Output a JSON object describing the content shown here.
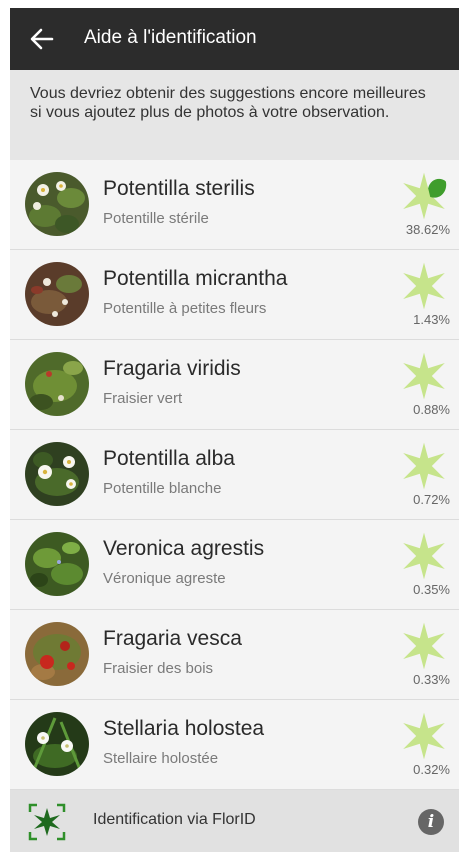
{
  "header": {
    "title": "Aide à l'identification",
    "back_icon": "arrow-left-icon"
  },
  "notice": {
    "text": "Vous devriez obtenir des suggestions encore meilleures si vous ajoutez plus de photos à votre observation."
  },
  "results": [
    {
      "scientific": "Potentilla sterilis",
      "common": "Potentille stérile",
      "percent": "38.62%",
      "score": 0.3862
    },
    {
      "scientific": "Potentilla micrantha",
      "common": "Potentille à petites fleurs",
      "percent": "1.43%",
      "score": 0.0143
    },
    {
      "scientific": "Fragaria viridis",
      "common": "Fraisier vert",
      "percent": "0.88%",
      "score": 0.0088
    },
    {
      "scientific": "Potentilla alba",
      "common": "Potentille blanche",
      "percent": "0.72%",
      "score": 0.0072
    },
    {
      "scientific": "Veronica agrestis",
      "common": "Véronique agreste",
      "percent": "0.35%",
      "score": 0.0035
    },
    {
      "scientific": "Fragaria vesca",
      "common": "Fraisier des bois",
      "percent": "0.33%",
      "score": 0.0033
    },
    {
      "scientific": "Stellaria holostea",
      "common": "Stellaire holostée",
      "percent": "0.32%",
      "score": 0.0032
    }
  ],
  "footer": {
    "label": "Identification via FlorID",
    "icon": "florid-leaf-icon",
    "info_icon": "info-icon",
    "info_glyph": "i"
  },
  "colors": {
    "appbar": "#2c2c2c",
    "score_light": "#c6e48b",
    "score_dark": "#3f9d2c"
  }
}
